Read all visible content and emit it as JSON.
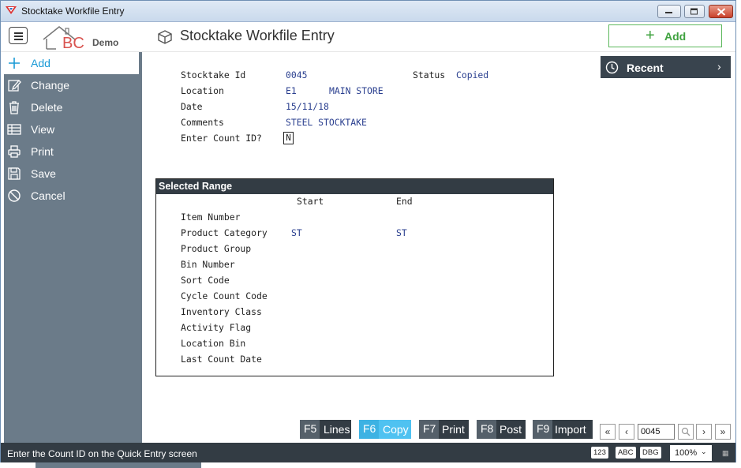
{
  "window": {
    "title": "Stocktake Workfile Entry"
  },
  "header": {
    "logo_text": "BC",
    "logo_sub": "Demo",
    "page_title": "Stocktake Workfile Entry",
    "add_label": "Add"
  },
  "sidebar": {
    "items": [
      {
        "label": "Add",
        "icon": "plus-icon"
      },
      {
        "label": "Change",
        "icon": "edit-icon"
      },
      {
        "label": "Delete",
        "icon": "trash-icon"
      },
      {
        "label": "View",
        "icon": "table-icon"
      },
      {
        "label": "Print",
        "icon": "printer-icon"
      },
      {
        "label": "Save",
        "icon": "save-icon"
      },
      {
        "label": "Cancel",
        "icon": "cancel-icon"
      }
    ]
  },
  "form": {
    "stocktake_id_label": "Stocktake Id",
    "stocktake_id": "0045",
    "status_label": "Status",
    "status": "Copied",
    "location_label": "Location",
    "location_code": "E1",
    "location_name": "MAIN STORE",
    "date_label": "Date",
    "date": "15/11/18",
    "comments_label": "Comments",
    "comments": "STEEL STOCKTAKE",
    "count_id_label": "Enter Count ID?",
    "count_id": "N"
  },
  "range": {
    "title": "Selected Range",
    "start_label": "Start",
    "end_label": "End",
    "rows": [
      {
        "label": "Item Number",
        "start": "",
        "end": ""
      },
      {
        "label": "Product Category",
        "start": "ST",
        "end": "ST"
      },
      {
        "label": "Product Group",
        "start": "",
        "end": ""
      },
      {
        "label": "Bin Number",
        "start": "",
        "end": ""
      },
      {
        "label": "Sort Code",
        "start": "",
        "end": ""
      },
      {
        "label": "Cycle Count Code",
        "start": "",
        "end": ""
      },
      {
        "label": "Inventory Class",
        "start": "",
        "end": ""
      },
      {
        "label": "Activity Flag",
        "start": "",
        "end": ""
      },
      {
        "label": "Location Bin",
        "start": "",
        "end": ""
      },
      {
        "label": "Last Count Date",
        "start": "",
        "end": ""
      }
    ]
  },
  "recent": {
    "label": "Recent"
  },
  "fkeys": [
    {
      "key": "F5",
      "label": "Lines"
    },
    {
      "key": "F6",
      "label": "Copy"
    },
    {
      "key": "F7",
      "label": "Print"
    },
    {
      "key": "F8",
      "label": "Post"
    },
    {
      "key": "F9",
      "label": "Import"
    }
  ],
  "nav": {
    "record": "0045"
  },
  "status": {
    "message": "Enter the Count ID on the Quick Entry screen",
    "badges": [
      "123",
      "ABC",
      "DBG"
    ],
    "zoom": "100%"
  },
  "colors": {
    "accent": "#1a9ad6",
    "sidebar": "#6b7b89",
    "dark": "#333c44",
    "value_text": "#2a3f8f",
    "add_green": "#3fa23f"
  }
}
